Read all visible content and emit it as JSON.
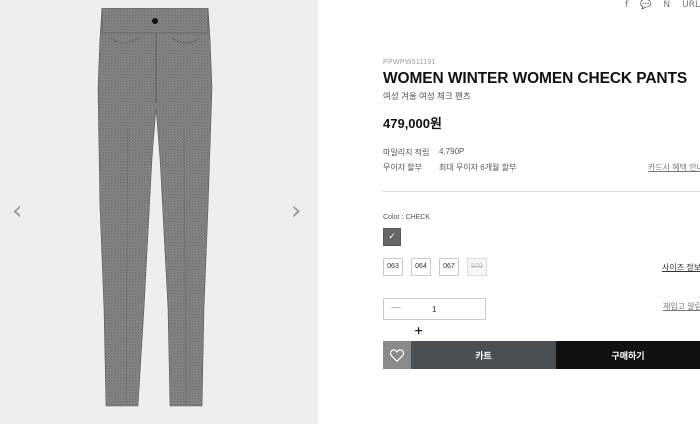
{
  "social": [
    "f",
    "💬",
    "N",
    "URL"
  ],
  "gallery": {
    "prev_icon": "chevron-left-icon",
    "next_icon": "chevron-right-icon",
    "prev_glyph": "‹",
    "next_glyph": "›"
  },
  "product": {
    "code": "PPWPW511191",
    "title": "WOMEN WINTER WOMEN CHECK PANTS",
    "subtitle": "여성 겨울 여성 체크 팬츠",
    "price": "479,000원"
  },
  "info": [
    {
      "label": "마일리지 적립",
      "value": "4,790P"
    },
    {
      "label": "무이자 할부",
      "value": "최대 무이자 6개월 할부"
    }
  ],
  "card_link": "카드사 혜택 안내",
  "color": {
    "label": "Color : CHECK",
    "check_glyph": "✓",
    "swatch": "#666666"
  },
  "sizes": [
    {
      "label": "063",
      "soldout": false
    },
    {
      "label": "064",
      "soldout": false
    },
    {
      "label": "067",
      "soldout": false
    },
    {
      "label": "070",
      "soldout": true
    }
  ],
  "size_guide": "사이즈 정보",
  "quantity": {
    "minus": "—",
    "value": "1"
  },
  "restock_link": "재입고 알림",
  "plus": "+",
  "actions": {
    "cart": "카트",
    "buy": "구매하기",
    "wish_icon": "heart-icon"
  },
  "colors": {
    "cart_bg": "#4a4f54",
    "buy_bg": "#111111",
    "wish_bg": "#8a8a8a",
    "gallery_bg": "#eeeeee"
  }
}
